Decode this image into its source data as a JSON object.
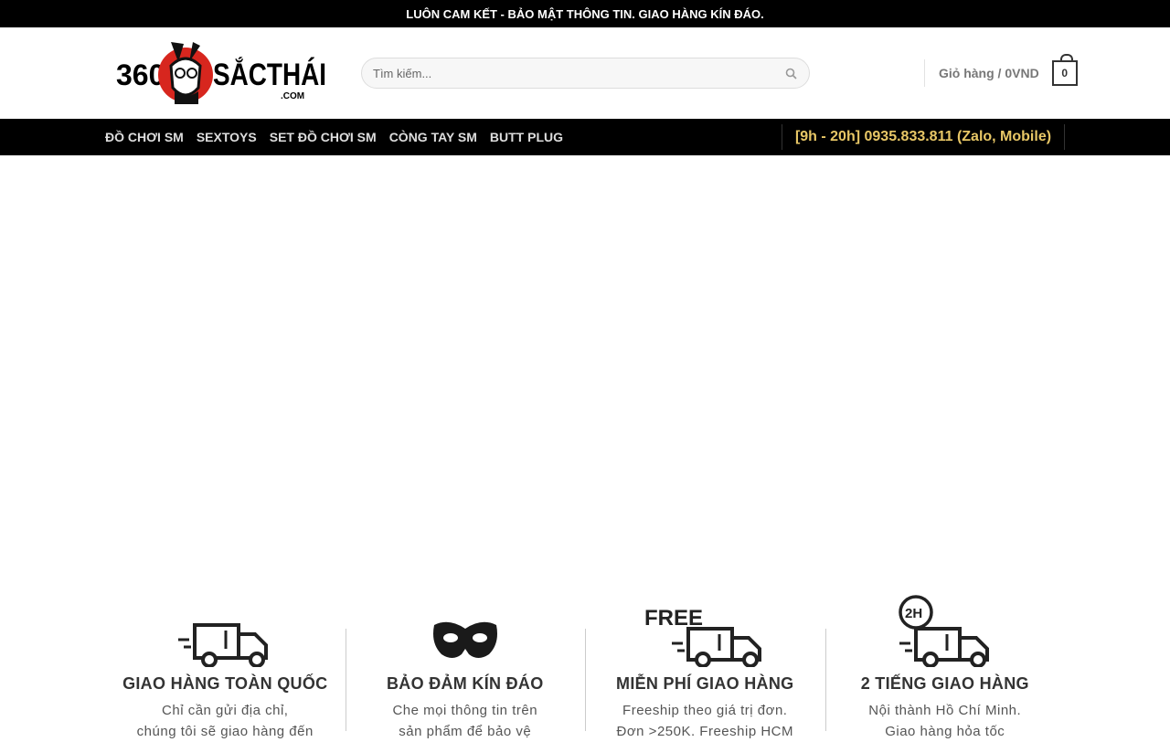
{
  "topbar": {
    "text": "LUÔN CAM KẾT - BẢO MẬT THÔNG TIN. GIAO HÀNG KÍN ĐÁO."
  },
  "logo": {
    "number": "360",
    "wordmark": "SẮCTHÁI",
    "domain": ".COM",
    "brand_red": "#d7261e"
  },
  "search": {
    "placeholder": "Tìm kiếm...",
    "icon": "search-icon"
  },
  "cart": {
    "label": "Giỏ hàng / 0VND",
    "count": "0",
    "icon": "cart-bag-icon"
  },
  "nav": {
    "items": [
      {
        "label": "ĐỒ CHƠI SM"
      },
      {
        "label": "SEXTOYS"
      },
      {
        "label": "SET ĐỒ CHƠI SM"
      },
      {
        "label": "CÒNG TAY SM"
      },
      {
        "label": "BUTT PLUG"
      }
    ],
    "phone": "[9h - 20h] 0935.833.811 (Zalo, Mobile)",
    "phone_color": "#e8c766"
  },
  "features": [
    {
      "icon": "truck-icon",
      "title": "GIAO HÀNG TOÀN QUỐC",
      "line1": "Chỉ cần gửi địa chỉ,",
      "line2": "chúng tôi sẽ giao hàng đến"
    },
    {
      "icon": "mask-icon",
      "title": "BẢO ĐẢM KÍN ĐÁO",
      "line1": "Che mọi thông tin trên",
      "line2": "sản phẩm để bảo vệ"
    },
    {
      "icon": "free-truck-icon",
      "badge": "FREE",
      "title": "MIỄN PHÍ GIAO HÀNG",
      "line1": "Freeship theo giá trị đơn.",
      "line2": "Đơn >250K. Freeship HCM"
    },
    {
      "icon": "2h-truck-icon",
      "badge": "2H",
      "title": "2 TIẾNG GIAO HÀNG",
      "line1": "Nội thành Hồ Chí Minh.",
      "line2": "Giao hàng hỏa tốc"
    }
  ]
}
